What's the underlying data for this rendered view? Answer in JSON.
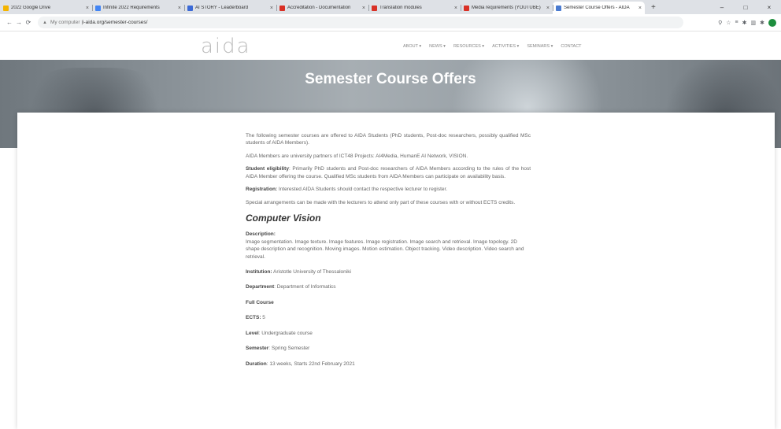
{
  "browser": {
    "tabs": [
      {
        "label": "2022 Google Drive",
        "color": "#f4b400"
      },
      {
        "label": "Infinite 2022 Requirements",
        "color": "#4285f4"
      },
      {
        "label": "AI STORY - Leaderboard",
        "color": "#3c6ad6"
      },
      {
        "label": "Accreditation - Documentation",
        "color": "#d93025"
      },
      {
        "label": "Translation modules",
        "color": "#d93025"
      },
      {
        "label": "Media requirements (YOUTUBE)",
        "color": "#d93025"
      },
      {
        "label": "Semester Course Offers - AIDA",
        "color": "#4a7bd0",
        "active": true
      }
    ],
    "new_tab": "+",
    "window_controls": [
      "–",
      "□",
      "×"
    ],
    "nav": {
      "back": "←",
      "forward": "→",
      "reload": "⟳"
    },
    "url_prefix": "▲",
    "url_host": "My computer | ",
    "url_path": "i-aida.org/semester-courses/",
    "ext_icons": [
      "⚲",
      "☆",
      "≡",
      "✱",
      "▥",
      "✱"
    ]
  },
  "site": {
    "logo": "aida",
    "nav": [
      "ABOUT ▾",
      "NEWS ▾",
      "RESOURCES ▾",
      "ACTIVITIES ▾",
      "SEMINARS ▾",
      "CONTACT"
    ]
  },
  "hero": {
    "title": "Semester Course Offers"
  },
  "content": {
    "intro": "The following semester courses are offered to AIDA Students (PhD students, Post-doc researchers, possibly qualified MSc students of AIDA Members).",
    "members": "AIDA Members are university partners of ICT48 Projects: AI4Media, HumanE AI Network, VISION.",
    "eligibility_label": "Student eligibility",
    "eligibility": ": Primarily PhD students and Post-doc researchers of AIDA Members according to the rules of the host AIDA Member offering the course. Qualified MSc students from AIDA Members can participate on availability basis.",
    "registration_label": "Registration:",
    "registration": " Interested AIDA Students should contact the respective lecturer to register.",
    "special": "Special arrangements can be made with the lecturers to attend only part of these courses with or without ECTS credits.",
    "course_title": "Computer Vision",
    "description_label": "Description:",
    "description": "Image segmentation. Image texture. Image features. Image registration. Image search and retrieval. Image topology. 2D shape description and recognition. Moving images. Motion estimation. Object tracking. Video description. Video search and retrieval.",
    "institution_label": "Institution:",
    "institution": " Aristotle University of Thessaloniki",
    "department_label": "Department",
    "department": ": Department of Informatics",
    "full_course": "Full Course",
    "ects_label": "ECTS:",
    "ects": " 5",
    "level_label": "Level",
    "level": ": Undergraduate course",
    "semester_label": "Semester",
    "semester": ": Spring Semester",
    "duration_label": "Duration",
    "duration": ": 13 weeks, Starts 22nd February 2021"
  }
}
